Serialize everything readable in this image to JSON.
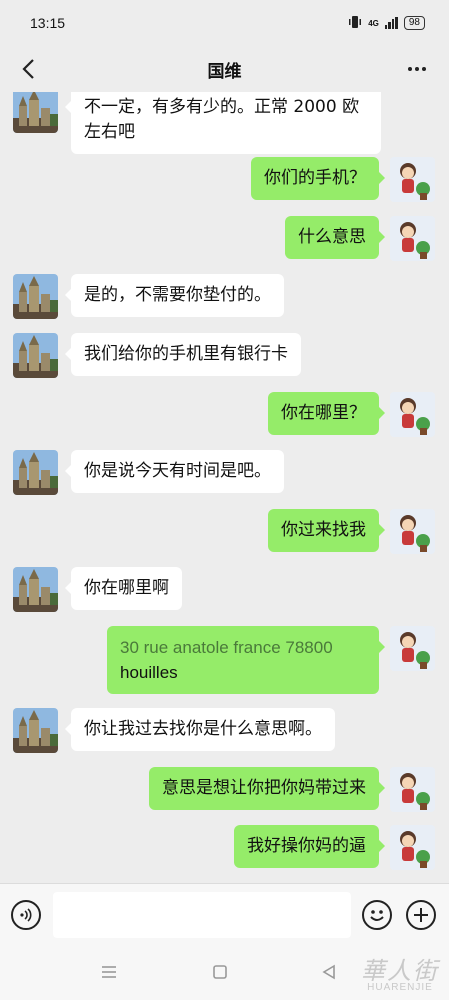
{
  "status_bar": {
    "time": "13:15",
    "network": "4G",
    "battery": "98"
  },
  "header": {
    "title": "国维",
    "back_icon": "back-arrow-icon",
    "more_icon": "more-dots-icon"
  },
  "messages": [
    {
      "from": "contact",
      "text": "不一定，有多有少的。正常 2000 欧左右吧"
    },
    {
      "from": "me",
      "text": "你们的手机？"
    },
    {
      "from": "me",
      "text": "什么意思"
    },
    {
      "from": "contact",
      "text": "是的，不需要你垫付的。"
    },
    {
      "from": "contact",
      "text": "我们给你的手机里有银行卡"
    },
    {
      "from": "me",
      "text": "你在哪里？"
    },
    {
      "from": "contact",
      "text": "你是说今天有时间是吧。"
    },
    {
      "from": "me",
      "text": "你过来找我"
    },
    {
      "from": "contact",
      "text": "你在哪里啊"
    },
    {
      "from": "me",
      "text_link": "30 rue anatole france 78800",
      "text_rest": "houilles"
    },
    {
      "from": "contact",
      "text": "你让我过去找你是什么意思啊。"
    },
    {
      "from": "me",
      "text": "意思是想让你把你妈带过来"
    },
    {
      "from": "me",
      "text": "我好操你妈的逼"
    }
  ],
  "input_bar": {
    "voice_icon": "voice-icon",
    "emoji_icon": "emoji-icon",
    "plus_icon": "plus-icon"
  },
  "system_nav": {
    "menu_icon": "menu-icon",
    "home_icon": "home-icon",
    "back_icon": "back-triangle-icon"
  },
  "watermark": {
    "cn": "華人街",
    "en": "HUARENJIE"
  },
  "colors": {
    "background": "#ededed",
    "incoming_bubble": "#ffffff",
    "outgoing_bubble": "#95ec69"
  }
}
